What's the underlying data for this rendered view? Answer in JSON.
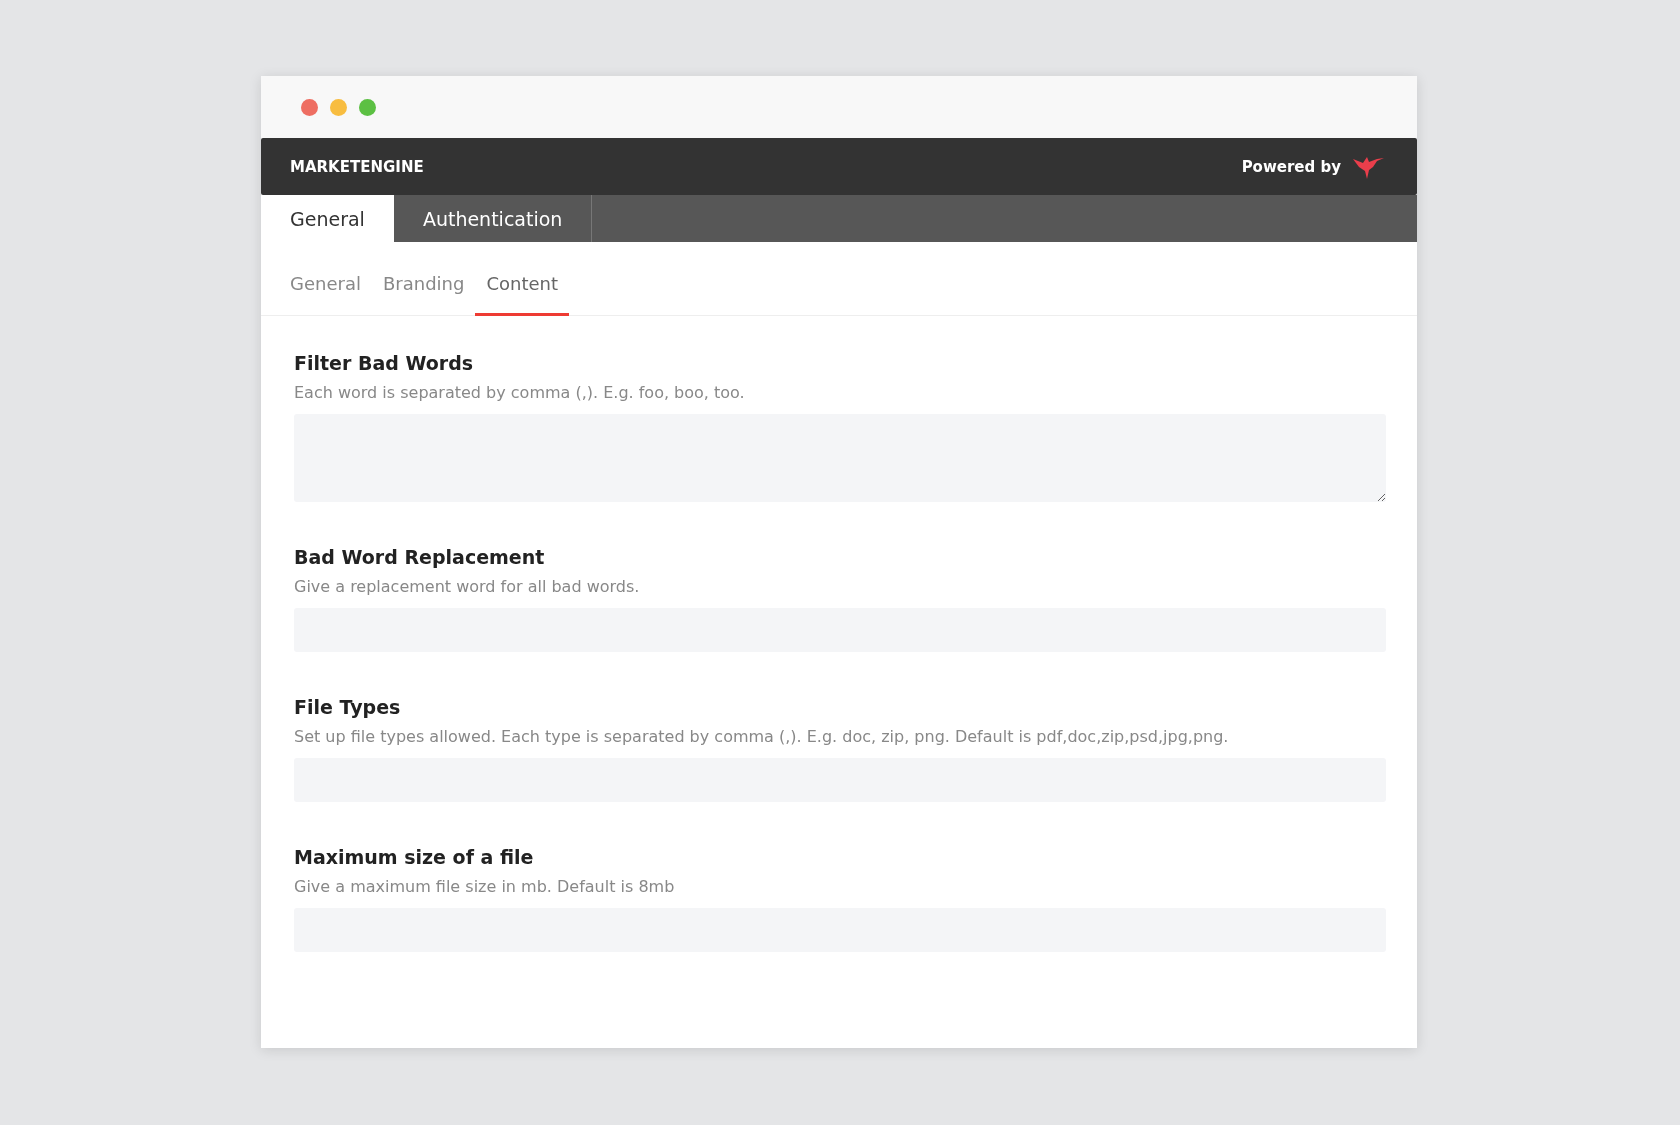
{
  "window": {
    "brand": "MARKETENGINE",
    "powered_by": "Powered by"
  },
  "tabs": [
    {
      "label": "General",
      "selected": true
    },
    {
      "label": "Authentication",
      "selected": false
    }
  ],
  "subtabs": [
    {
      "label": "General",
      "selected": false
    },
    {
      "label": "Branding",
      "selected": false
    },
    {
      "label": "Content",
      "selected": true
    }
  ],
  "fields": [
    {
      "kind": "textarea",
      "label": "Filter Bad Words",
      "help": "Each word is separated by comma (,). E.g. foo, boo, too."
    },
    {
      "kind": "input",
      "label": "Bad Word Replacement",
      "help": "Give a replacement word for all bad words."
    },
    {
      "kind": "input",
      "label": "File Types",
      "help": "Set up file types allowed. Each type is separated by comma (,). E.g. doc, zip, png. Default is pdf,doc,zip,psd,jpg,png."
    },
    {
      "kind": "input",
      "label": "Maximum size of a file",
      "help": "Give a maximum file size in mb. Default is 8mb"
    }
  ]
}
